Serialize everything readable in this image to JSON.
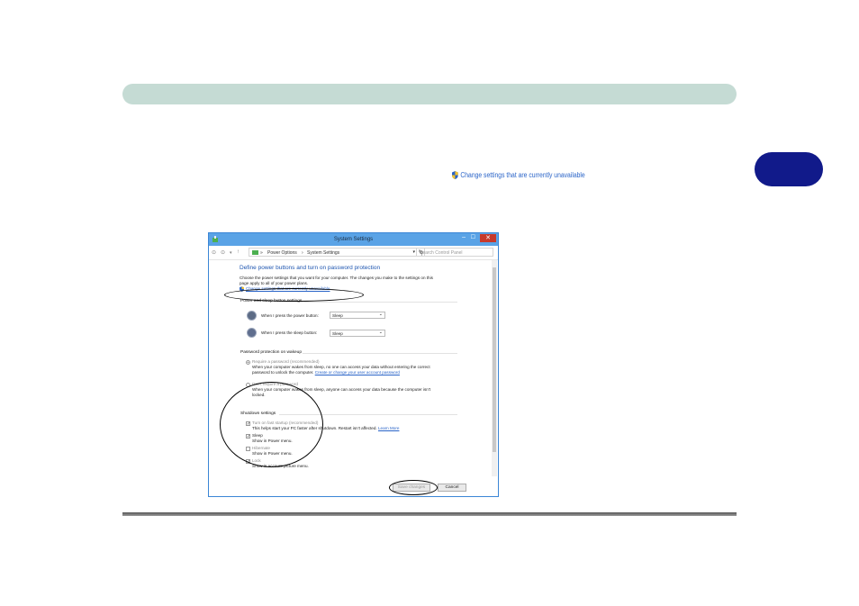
{
  "inline_link": {
    "text": "Change settings that are currently unavailable"
  },
  "window": {
    "title": "System Settings",
    "address": {
      "root_separator": "»",
      "crumb1": "Power Options",
      "crumb_separator": "›",
      "crumb2": "System Settings"
    },
    "search_placeholder": "Search Control Panel",
    "heading": "Define power buttons and turn on password protection",
    "intro_line1": "Choose the power settings that you want for your computer. The changes you make to the settings on this",
    "intro_line2": "page apply to all of your power plans.",
    "change_link": "Change settings that are currently unavailable",
    "power_section": "Power and sleep button settings",
    "power_button_label": "When I press the power button:",
    "power_button_value": "Sleep",
    "sleep_button_label": "When I press the sleep button:",
    "sleep_button_value": "Sleep",
    "password_section": "Password protection on wakeup",
    "require_password": "Require a password (recommended)",
    "require_desc1": "When your computer wakes from sleep, no one can access your data without entering the correct",
    "require_desc2_prefix": "password to unlock the computer.",
    "require_desc2_link": "Create or change your user account password",
    "no_password": "Don't require a password",
    "no_password_desc1": "When your computer wakes from sleep, anyone can access your data because the computer isn't",
    "no_password_desc2": "locked.",
    "shutdown_section": "Shutdown settings",
    "fast_startup": "Turn on fast startup (recommended)",
    "fast_startup_desc": "This helps start your PC faster after shutdown. Restart isn't affected.",
    "learn_more": "Learn More",
    "sleep_label": "Sleep",
    "sleep_desc": "Show in Power menu.",
    "hibernate_label": "Hibernate",
    "hibernate_desc": "Show in Power menu.",
    "lock_label": "Lock",
    "lock_desc": "Show in account picture menu.",
    "save_button": "Save changes",
    "cancel_button": "Cancel"
  },
  "colors": {
    "header_bar": "#c5dbd4",
    "chapter_tab": "#111a8a",
    "link": "#2a64c8",
    "titlebar": "#5aa3e6"
  }
}
